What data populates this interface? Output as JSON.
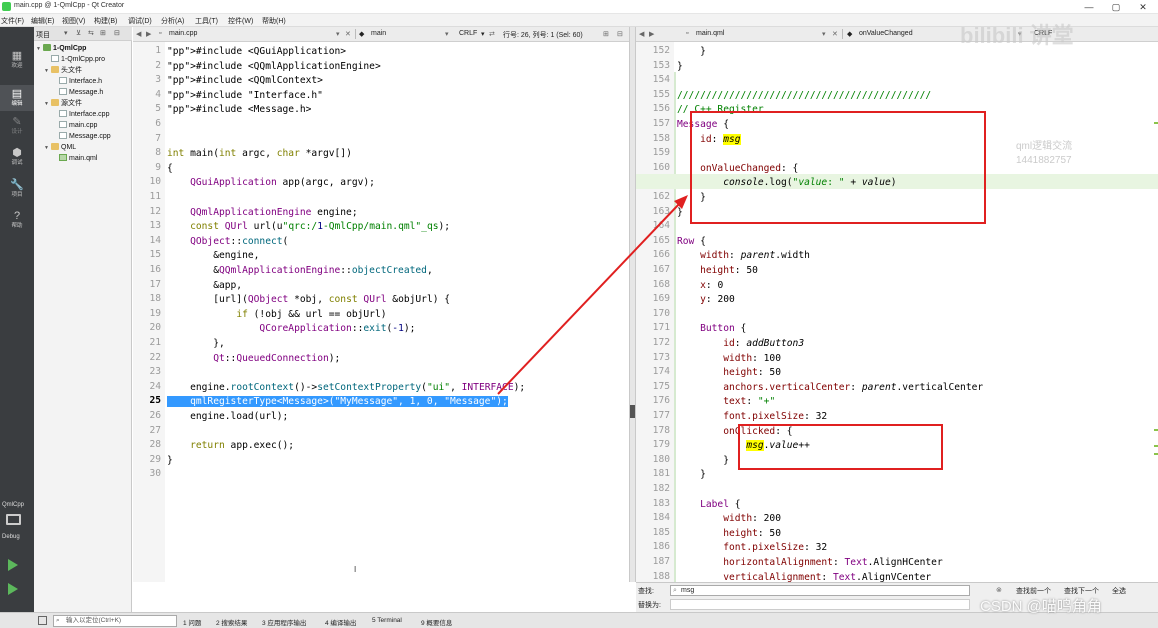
{
  "window": {
    "title": "main.cpp @ 1-QmlCpp - Qt Creator",
    "buttons": [
      "—",
      "▢",
      "✕"
    ]
  },
  "menu": [
    "文件(F)",
    "编辑(E)",
    "视图(V)",
    "构建(B)",
    "调试(D)",
    "分析(A)",
    "工具(T)",
    "控件(W)",
    "帮助(H)"
  ],
  "modes": [
    {
      "label": "欢迎",
      "icon": "▦"
    },
    {
      "label": "编辑",
      "icon": "▤"
    },
    {
      "label": "设计",
      "icon": "✎"
    },
    {
      "label": "调试",
      "icon": "⬢"
    },
    {
      "label": "项目",
      "icon": "🔧"
    },
    {
      "label": "帮助",
      "icon": "?"
    }
  ],
  "kit": {
    "project": "QmlCpp",
    "mode": "Debug"
  },
  "project_panel": {
    "header": "项目",
    "tree": [
      {
        "label": "1-QmlCpp",
        "level": 0,
        "kind": "proj",
        "bold": true,
        "arrow": "▼"
      },
      {
        "label": "1-QmlCpp.pro",
        "level": 1,
        "kind": "file",
        "arrow": ""
      },
      {
        "label": "头文件",
        "level": 1,
        "kind": "folder",
        "arrow": "▼"
      },
      {
        "label": "Interface.h",
        "level": 2,
        "kind": "file",
        "arrow": ""
      },
      {
        "label": "Message.h",
        "level": 2,
        "kind": "file",
        "arrow": ""
      },
      {
        "label": "源文件",
        "level": 1,
        "kind": "folder",
        "arrow": "▼"
      },
      {
        "label": "Interface.cpp",
        "level": 2,
        "kind": "file",
        "arrow": ""
      },
      {
        "label": "main.cpp",
        "level": 2,
        "kind": "file",
        "arrow": ""
      },
      {
        "label": "Message.cpp",
        "level": 2,
        "kind": "file",
        "arrow": ""
      },
      {
        "label": "QML",
        "level": 1,
        "kind": "folder",
        "arrow": "▼"
      },
      {
        "label": "main.qml",
        "level": 2,
        "kind": "qml",
        "arrow": ""
      }
    ]
  },
  "cpp_editor": {
    "file_tab": "main.cpp",
    "symbol": "main",
    "line_ending": "CRLF",
    "cursor_info": "行号: 26, 列号: 1 (Sel: 60)",
    "current_line": 25,
    "lines": [
      "#include <QGuiApplication>",
      "#include <QQmlApplicationEngine>",
      "#include <QQmlContext>",
      "#include \"Interface.h\"",
      "#include <Message.h>",
      "",
      "",
      "int main(int argc, char *argv[])",
      "{",
      "    QGuiApplication app(argc, argv);",
      "",
      "    QQmlApplicationEngine engine;",
      "    const QUrl url(u\"qrc:/1-QmlCpp/main.qml\"_qs);",
      "    QObject::connect(",
      "        &engine,",
      "        &QQmlApplicationEngine::objectCreated,",
      "        &app,",
      "        [url](QObject *obj, const QUrl &objUrl) {",
      "            if (!obj && url == objUrl)",
      "                QCoreApplication::exit(-1);",
      "        },",
      "        Qt::QueuedConnection);",
      "",
      "    engine.rootContext()->setContextProperty(\"ui\", INTERFACE);",
      "    qmlRegisterType<Message>(\"MyMessage\", 1, 0, \"Message\");",
      "    engine.load(url);",
      "",
      "    return app.exec();",
      "}",
      ""
    ]
  },
  "qml_editor": {
    "file_tab": "main.qml",
    "symbol": "onValueChanged",
    "line_ending": "CRLF",
    "current_line": 161,
    "first_line": 152,
    "lines": [
      "    }",
      "}",
      "",
      "////////////////////////////////////////////",
      "// C++ Register",
      "Message {",
      "    id: msg",
      "",
      "    onValueChanged: {",
      "        console.log(\"value: \" + value)",
      "    }",
      "}",
      "",
      "Row {",
      "    width: parent.width",
      "    height: 50",
      "    x: 0",
      "    y: 200",
      "",
      "    Button {",
      "        id: addButton3",
      "        width: 100",
      "        height: 50",
      "        anchors.verticalCenter: parent.verticalCenter",
      "        text: \"+\"",
      "        font.pixelSize: 32",
      "        onClicked: {",
      "            msg.value++",
      "        }",
      "    }",
      "",
      "    Label {",
      "        width: 200",
      "        height: 50",
      "        font.pixelSize: 32",
      "        horizontalAlignment: Text.AlignHCenter",
      "        verticalAlignment: Text.AlignVCenter"
    ]
  },
  "findbar": {
    "find_label": "查找:",
    "replace_label": "替换为:",
    "find_value": "msg",
    "find_prev": "查找前一个",
    "find_next": "查找下一个",
    "find_all": "全选"
  },
  "statusbar": {
    "locator_placeholder": "输入以定位(Ctrl+K)",
    "panes": [
      "1 问题",
      "2 搜索结果",
      "3 应用程序输出",
      "4 编译输出",
      "5 Terminal",
      "9 概要信息"
    ]
  },
  "watermark": "CSDN @喵鸣角角",
  "watermark_top": "bilibili 讲堂",
  "watermark_qq": "qml逻辑交流\n1441882757",
  "colors": {
    "accent_red": "#e02020",
    "selection": "#3399ff",
    "search_highlight": "#ffff00"
  }
}
